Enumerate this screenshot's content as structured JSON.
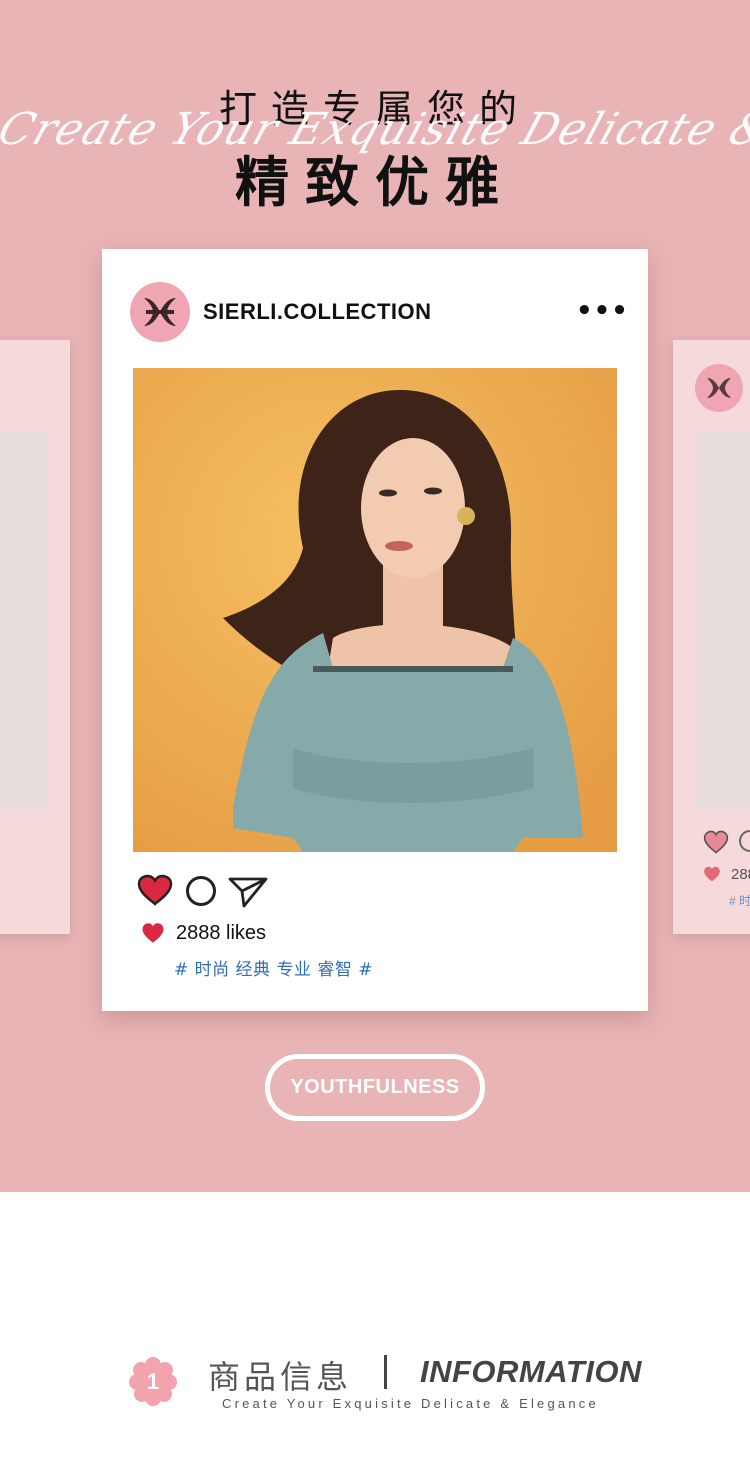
{
  "hero": {
    "title_top": "打造专属您的",
    "script_text": "Create Your Exquisite Delicate & Elegance",
    "title_main": "精致优雅"
  },
  "post": {
    "handle": "SIERLI.COLLECTION",
    "more": "•••",
    "likes": "2888 likes",
    "tags": "# 时尚 经典 专业 睿智 #",
    "heart_color": "#d9283f"
  },
  "side_post": {
    "likes": "288",
    "tags": "# 时"
  },
  "pill": {
    "label": "YOUTHFULNESS"
  },
  "info": {
    "number": "1",
    "title_cn": "商品信息",
    "title_en": "INFORMATION",
    "subtitle": "Create Your Exquisite Delicate & Elegance"
  },
  "colors": {
    "background_pink": "#e8b4b6",
    "card_white": "#ffffff",
    "tag_blue": "#2f6fb8",
    "logo_pink": "#f0a6b2"
  },
  "icons": [
    "logo-icon",
    "heart-icon",
    "comment-icon",
    "share-icon",
    "more-icon",
    "flower-number-icon"
  ]
}
